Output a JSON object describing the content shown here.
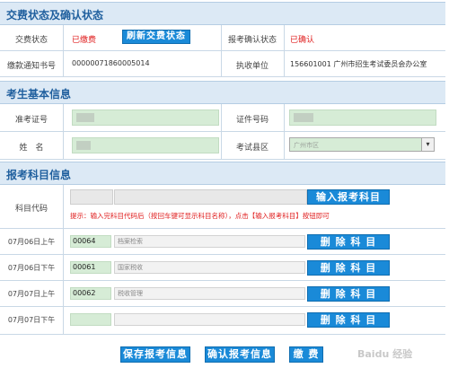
{
  "payment_section": {
    "title": "交费状态及确认状态",
    "fee_status_label": "交费状态",
    "fee_status_value": "已缴费",
    "refresh_button": "刷新交费状态",
    "confirm_status_label": "报考确认状态",
    "confirm_status_value": "已确认",
    "notice_no_label": "缴款通知书号",
    "notice_no_value": "00000071860005014",
    "collector_label": "执收单位",
    "collector_value": "156601001 广州市招生考试委员会办公室"
  },
  "candidate_section": {
    "title": "考生基本信息",
    "exam_id_label": "准考证号",
    "id_no_label": "证件号码",
    "name_label": "姓　名",
    "district_label": "考试县区",
    "district_value": "广州市区"
  },
  "subject_section": {
    "title": "报考科目信息",
    "code_label": "科目代码",
    "enter_button": "输入报考科目",
    "hint": "提示：输入完科目代码后（按回车键可显示科目名称），点击【输入报考科目】按钮即可",
    "delete_button": "删 除 科 目",
    "rows": [
      {
        "time": "07月06日上午",
        "code": "00064",
        "name": "档案检索"
      },
      {
        "time": "07月06日下午",
        "code": "00061",
        "name": "国家税收"
      },
      {
        "time": "07月07日上午",
        "code": "00062",
        "name": "税收管理"
      },
      {
        "time": "07月07日下午",
        "code": "",
        "name": ""
      }
    ]
  },
  "footer": {
    "save_button": "保存报考信息",
    "confirm_button": "确认报考信息",
    "pay_button": "缴 费"
  },
  "watermark": "Baidu 经验"
}
